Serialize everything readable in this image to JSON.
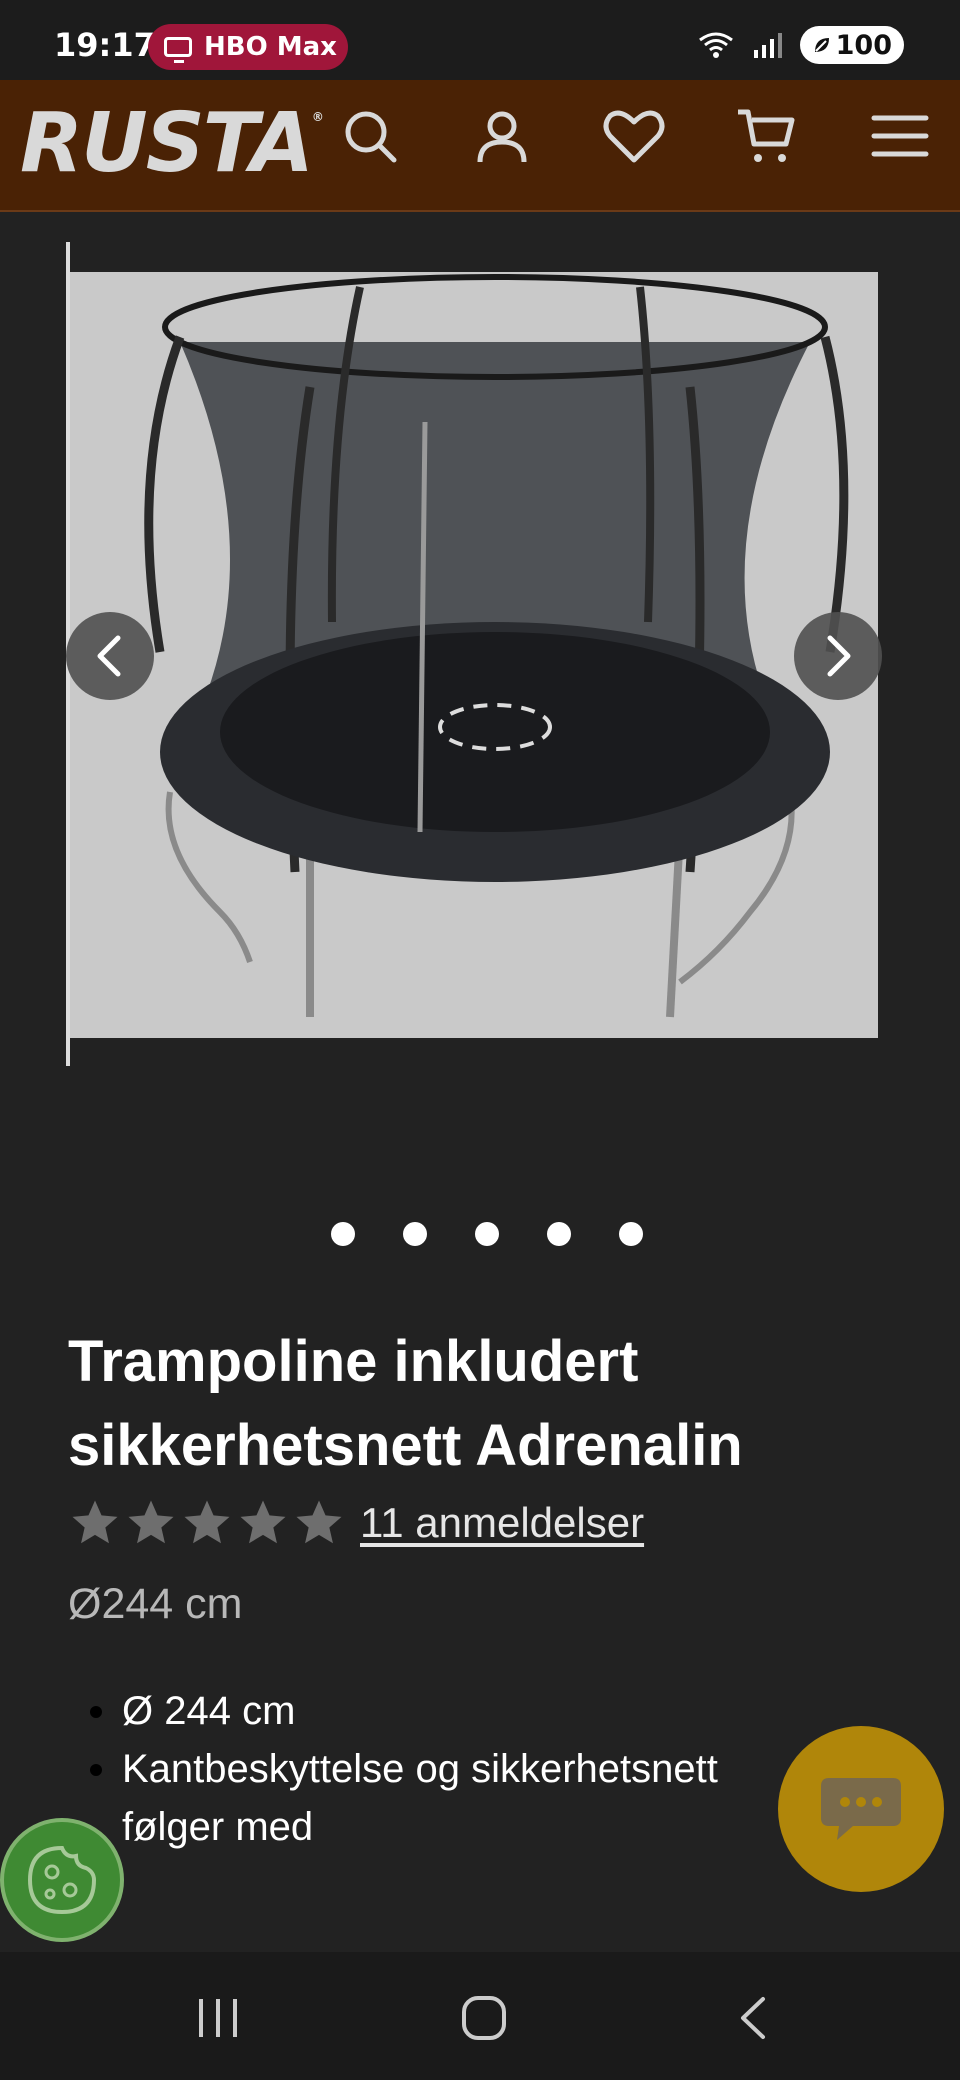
{
  "status_bar": {
    "time": "19:17",
    "notification_label": "HBO Max",
    "battery": "100"
  },
  "header": {
    "logo_text": "RUSTA",
    "logo_mark": "®",
    "icons": [
      "search-icon",
      "account-icon",
      "heart-icon",
      "cart-icon",
      "menu-icon"
    ]
  },
  "gallery": {
    "image_alt": "trampoline-image",
    "dot_count": 5,
    "prev_icon": "chevron-left-icon",
    "next_icon": "chevron-right-icon"
  },
  "product": {
    "title_line1": "Trampoline inkludert",
    "title_line2": "sikkerhetsnett Adrenalin",
    "rating_stars": 5,
    "reviews_link": "11 anmeldelser",
    "size": "Ø244 cm",
    "features": [
      "Ø 244 cm",
      "Kantbeskyttelse og sikkerhetsnett følger med"
    ]
  },
  "colors": {
    "header_bg": "#4a2205",
    "chat_button": "#b0860a",
    "cookie_button": "#3f8a33",
    "notification_pill": "#a0163a",
    "page_bg": "#222222"
  }
}
